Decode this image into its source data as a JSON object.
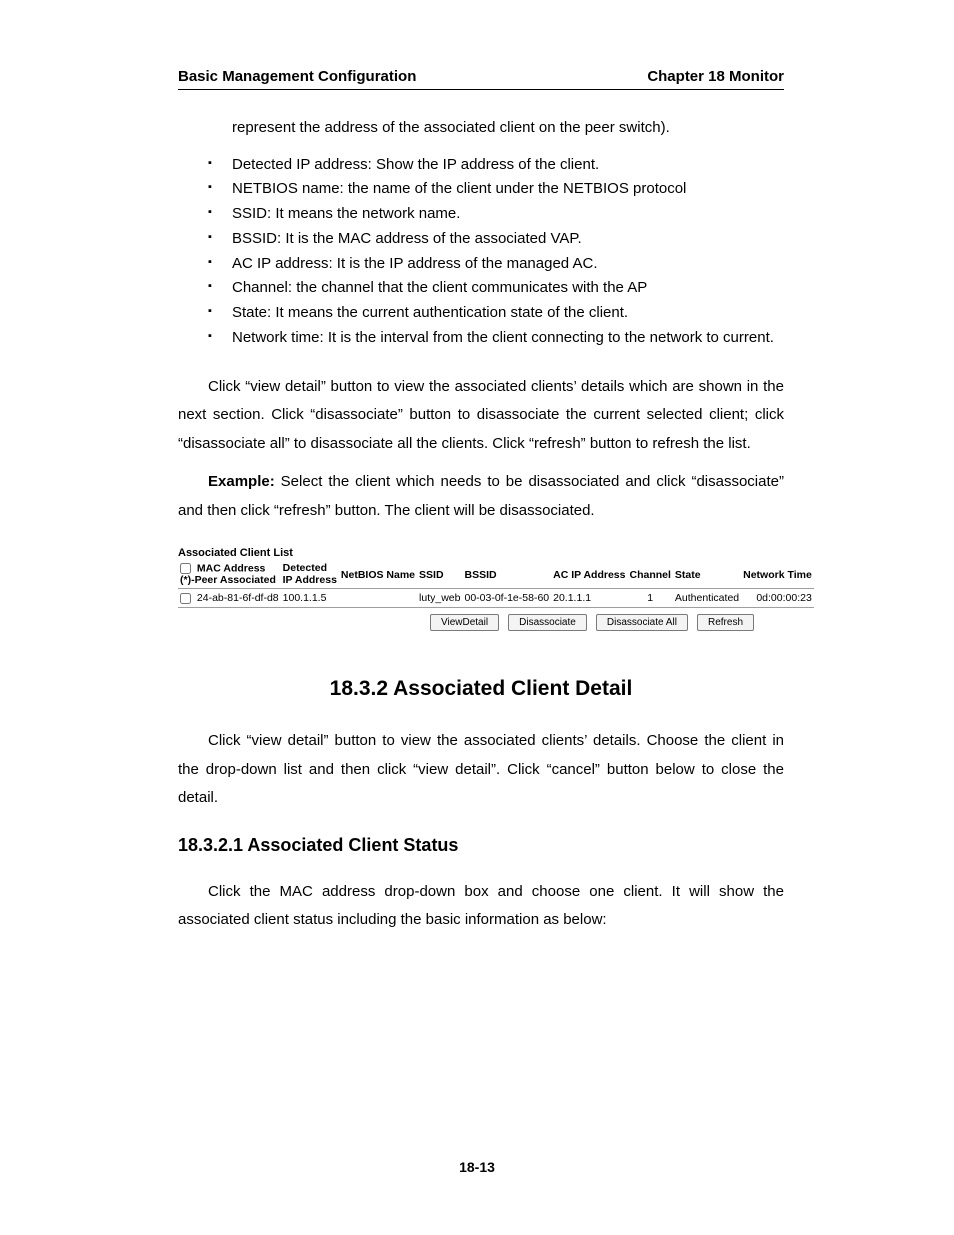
{
  "header": {
    "left": "Basic Management Configuration",
    "right": "Chapter 18 Monitor"
  },
  "intro_line": "represent the address of the associated client on the peer switch).",
  "bullets": [
    "Detected IP address: Show the IP address of the client.",
    "NETBIOS name: the name of the client under the NETBIOS protocol",
    "SSID: It means the network name.",
    "BSSID: It is the MAC address of the associated VAP.",
    "AC IP address: It is the IP address of the managed AC.",
    "Channel: the channel that the client communicates with the AP",
    "State: It means the current authentication state of the client.",
    "Network time: It is the interval from the client connecting to the network to current."
  ],
  "para1": "Click “view detail” button to view the associated clients’ details which are shown in the next section. Click “disassociate” button to disassociate the current selected client; click “disassociate all” to disassociate all the clients. Click “refresh” button to refresh the list.",
  "para2_strong": "Example:",
  "para2_rest": " Select the client which needs to be disassociated and click “disassociate” and then click “refresh” button. The client will be disassociated.",
  "shot": {
    "title": "Associated Client List",
    "cols": {
      "mac1": "MAC Address",
      "mac2": "(*)-Peer Associated",
      "ip1": "Detected",
      "ip2": "IP Address",
      "netbios": "NetBIOS Name",
      "ssid": "SSID",
      "bssid": "BSSID",
      "acip": "AC IP Address",
      "channel": "Channel",
      "state": "State",
      "nettime": "Network Time"
    },
    "row": {
      "mac": "24-ab-81-6f-df-d8",
      "ip": "100.1.1.5",
      "netbios": "",
      "ssid": "luty_web",
      "bssid": "00-03-0f-1e-58-60",
      "acip": "20.1.1.1",
      "channel": "1",
      "state": "Authenticated",
      "nettime": "0d:00:00:23"
    },
    "buttons": {
      "viewdetail": "ViewDetail",
      "disassociate": "Disassociate",
      "disall": "Disassociate All",
      "refresh": "Refresh"
    }
  },
  "h2": "18.3.2 Associated Client Detail",
  "para3": "Click “view detail” button to view the associated clients’ details. Choose the client in the drop-down list and then click “view detail”. Click “cancel” button below to close the detail.",
  "h3": "18.3.2.1 Associated Client Status",
  "para4": "Click the MAC address drop-down box and choose one client. It will show the associated client status including the basic information as below:",
  "pagenum": "18-13"
}
